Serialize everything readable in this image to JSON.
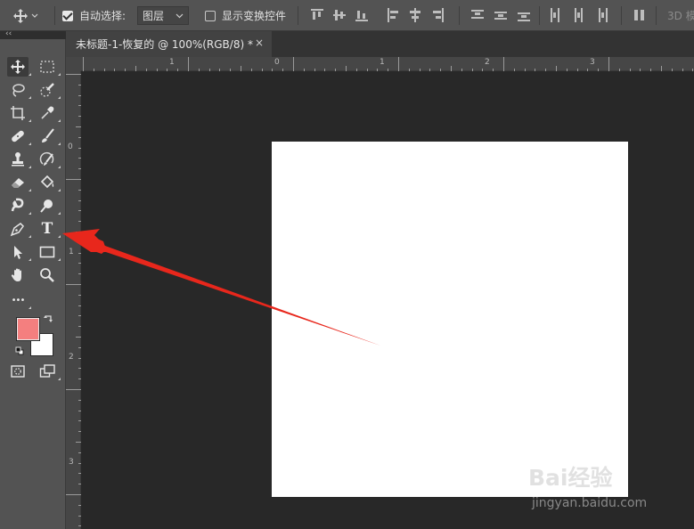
{
  "options_bar": {
    "auto_select_label": "自动选择:",
    "auto_select_checked": true,
    "auto_select_target": "图层",
    "show_transform_label": "显示变换控件",
    "show_transform_checked": false,
    "mode_3d_label": "3D 模"
  },
  "document_tab": {
    "title": "未标题-1-恢复的 @ 100%(RGB/8) *",
    "close_glyph": "×"
  },
  "toolbar": {
    "collapse_glyph": "‹‹",
    "tools": [
      {
        "name": "move-tool",
        "icon": "move-icon",
        "active": true
      },
      {
        "name": "marquee-tool",
        "icon": "rect-marquee-icon"
      },
      {
        "name": "lasso-tool",
        "icon": "lasso-icon"
      },
      {
        "name": "quick-select-tool",
        "icon": "quick-select-icon"
      },
      {
        "name": "crop-tool",
        "icon": "crop-icon"
      },
      {
        "name": "eyedropper-tool",
        "icon": "eyedropper-icon"
      },
      {
        "name": "healing-brush-tool",
        "icon": "bandage-icon"
      },
      {
        "name": "brush-tool",
        "icon": "brush-icon"
      },
      {
        "name": "clone-stamp-tool",
        "icon": "stamp-icon"
      },
      {
        "name": "history-brush-tool",
        "icon": "history-brush-icon"
      },
      {
        "name": "eraser-tool",
        "icon": "eraser-icon"
      },
      {
        "name": "paint-bucket-tool",
        "icon": "bucket-icon"
      },
      {
        "name": "blur-tool",
        "icon": "blur-icon"
      },
      {
        "name": "dodge-tool",
        "icon": "dodge-icon"
      },
      {
        "name": "pen-tool",
        "icon": "pen-icon"
      },
      {
        "name": "type-tool",
        "icon": "type-icon",
        "glyph": "T"
      },
      {
        "name": "path-select-tool",
        "icon": "arrow-select-icon"
      },
      {
        "name": "rectangle-tool",
        "icon": "rectangle-icon"
      },
      {
        "name": "hand-tool",
        "icon": "hand-icon"
      },
      {
        "name": "zoom-tool",
        "icon": "zoom-icon"
      },
      {
        "name": "edit-toolbar",
        "icon": "more-icon",
        "glyph": "•••"
      }
    ],
    "foreground_color": "#f47f7f",
    "background_color": "#ffffff"
  },
  "rulers": {
    "horizontal": [
      "1",
      "0",
      "1",
      "2",
      "3"
    ],
    "vertical": [
      "0",
      "1",
      "2",
      "3"
    ]
  },
  "canvas": {
    "document_color": "#ffffff",
    "workspace_color": "#282828",
    "annotation_arrow_color": "#e8271c"
  },
  "watermark": {
    "brand": "Bai经验",
    "url": "jingyan.baidu.com"
  }
}
